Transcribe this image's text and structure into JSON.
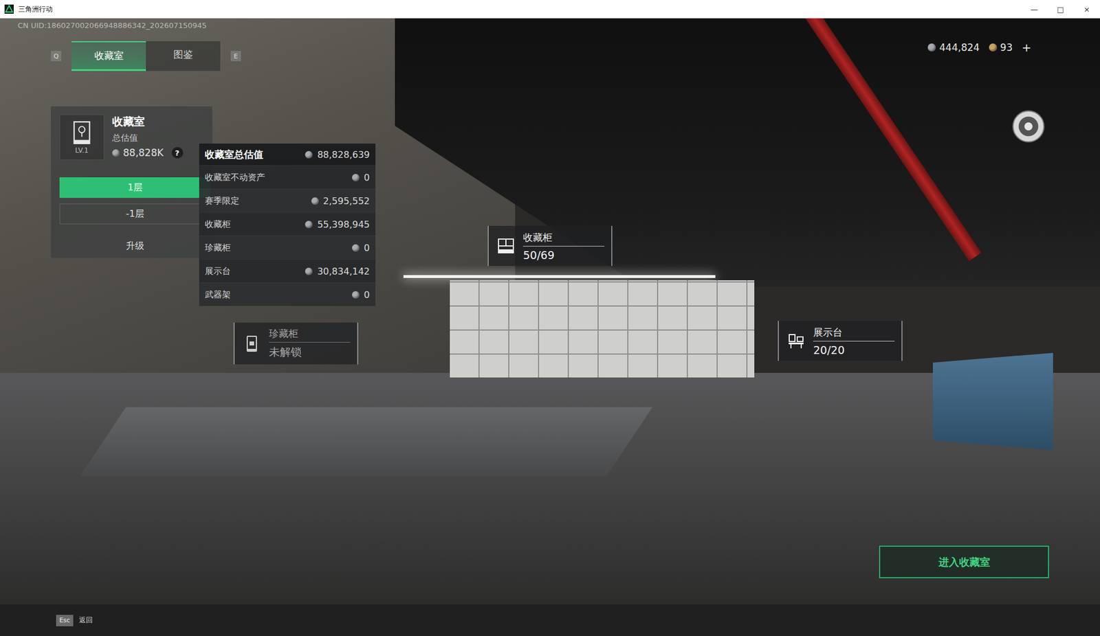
{
  "window": {
    "title": "三角洲行动",
    "controls": [
      "—",
      "□",
      "×"
    ]
  },
  "uid": "CN UID:186027002066948886342_202607150945",
  "tabs": {
    "prev_key": "Q",
    "next_key": "E",
    "items": [
      {
        "label": "收藏室",
        "selected": true
      },
      {
        "label": "图鉴",
        "selected": false
      }
    ]
  },
  "currency": {
    "items": [
      {
        "amount": "444,824",
        "color": "#a7abb0"
      },
      {
        "amount": "93",
        "color": "#c9a565"
      }
    ],
    "add": "+"
  },
  "collection_panel": {
    "title": "收藏室",
    "subtitle": "总估值",
    "level": "LV.1",
    "value": "88,828K",
    "help": "?",
    "floors": [
      {
        "label": "1层",
        "selected": true
      },
      {
        "label": "-1层",
        "selected": false
      }
    ],
    "upgrade": "升级"
  },
  "tooltip": {
    "title": "收藏室总估值",
    "total": "88,828,639",
    "rows": [
      {
        "label": "收藏室不动资产",
        "value": "0"
      },
      {
        "label": "赛季限定",
        "value": "2,595,552"
      },
      {
        "label": "收藏柜",
        "value": "55,398,945"
      },
      {
        "label": "珍藏柜",
        "value": "0"
      },
      {
        "label": "展示台",
        "value": "30,834,142"
      },
      {
        "label": "武器架",
        "value": "0"
      }
    ]
  },
  "markers": [
    {
      "kind": "cabinet",
      "name": "收藏柜",
      "status": "50/69",
      "locked": false
    },
    {
      "kind": "vault",
      "name": "珍藏柜",
      "status": "未解锁",
      "locked": true
    },
    {
      "kind": "stand",
      "name": "展示台",
      "status": "20/20",
      "locked": false
    }
  ],
  "enter_button": "进入收藏室",
  "footer": {
    "key": "Esc",
    "label": "返回"
  }
}
